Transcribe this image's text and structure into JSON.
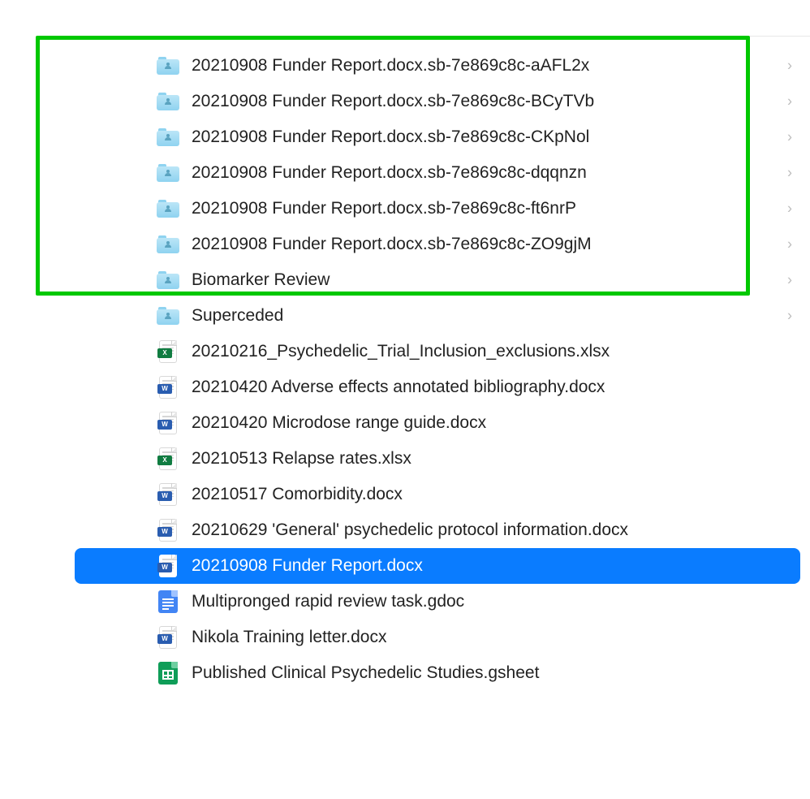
{
  "items": [
    {
      "name": "20210908 Funder Report.docx.sb-7e869c8c-aAFL2x",
      "type": "folder",
      "hasChevron": true,
      "selected": false
    },
    {
      "name": "20210908 Funder Report.docx.sb-7e869c8c-BCyTVb",
      "type": "folder",
      "hasChevron": true,
      "selected": false
    },
    {
      "name": "20210908 Funder Report.docx.sb-7e869c8c-CKpNol",
      "type": "folder",
      "hasChevron": true,
      "selected": false
    },
    {
      "name": "20210908 Funder Report.docx.sb-7e869c8c-dqqnzn",
      "type": "folder",
      "hasChevron": true,
      "selected": false
    },
    {
      "name": "20210908 Funder Report.docx.sb-7e869c8c-ft6nrP",
      "type": "folder",
      "hasChevron": true,
      "selected": false
    },
    {
      "name": "20210908 Funder Report.docx.sb-7e869c8c-ZO9gjM",
      "type": "folder",
      "hasChevron": true,
      "selected": false
    },
    {
      "name": "Biomarker Review",
      "type": "folder",
      "hasChevron": true,
      "selected": false
    },
    {
      "name": "Superceded",
      "type": "folder",
      "hasChevron": true,
      "selected": false
    },
    {
      "name": "20210216_Psychedelic_Trial_Inclusion_exclusions.xlsx",
      "type": "excel",
      "hasChevron": false,
      "selected": false
    },
    {
      "name": "20210420 Adverse effects annotated bibliography.docx",
      "type": "word",
      "hasChevron": false,
      "selected": false
    },
    {
      "name": "20210420 Microdose range guide.docx",
      "type": "word",
      "hasChevron": false,
      "selected": false
    },
    {
      "name": "20210513 Relapse rates.xlsx",
      "type": "excel",
      "hasChevron": false,
      "selected": false
    },
    {
      "name": "20210517 Comorbidity.docx",
      "type": "word",
      "hasChevron": false,
      "selected": false
    },
    {
      "name": "20210629 'General' psychedelic protocol information.docx",
      "type": "word",
      "hasChevron": false,
      "selected": false
    },
    {
      "name": "20210908 Funder Report.docx",
      "type": "word",
      "hasChevron": false,
      "selected": true
    },
    {
      "name": "Multipronged rapid review task.gdoc",
      "type": "gdoc",
      "hasChevron": false,
      "selected": false
    },
    {
      "name": "Nikola Training letter.docx",
      "type": "word",
      "hasChevron": false,
      "selected": false
    },
    {
      "name": "Published Clinical Psychedelic Studies.gsheet",
      "type": "gsheet",
      "hasChevron": false,
      "selected": false
    }
  ],
  "highlightedRange": {
    "start": 0,
    "end": 5
  },
  "icons": {
    "wordBadge": "W",
    "excelBadge": "X"
  }
}
